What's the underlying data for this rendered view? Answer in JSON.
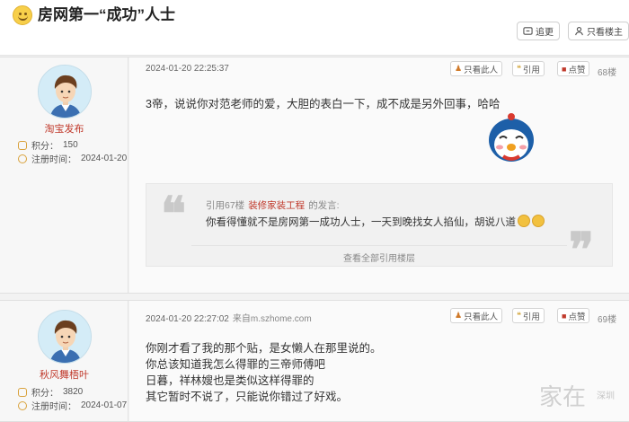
{
  "header": {
    "title": "房网第一“成功”人士",
    "btn_follow": "追更",
    "btn_only_op": "只看楼主"
  },
  "posts": [
    {
      "user": {
        "name": "淘宝发布",
        "score_label": "积分：",
        "score": "150",
        "reg_label": "注册时间：",
        "reg": "2024-01-20"
      },
      "time": "2024-01-20 22:25:37",
      "source": "",
      "btn_only": "只看此人",
      "btn_quote": "引用",
      "btn_like": "点赞",
      "floor": "68楼",
      "content": [
        "3帝，说说你对范老师的爱，大胆的表白一下，成不成是另外回事，哈哈"
      ],
      "quote": {
        "prefix": "引用67楼",
        "name": "装修家装工程",
        "suffix": "的发言:",
        "text": "你看得懂就不是房网第一成功人士，一天到晚找女人掐仙，胡说八道",
        "all": "查看全部引用楼层"
      }
    },
    {
      "user": {
        "name": "秋风舞梧叶",
        "score_label": "积分：",
        "score": "3820",
        "reg_label": "注册时间：",
        "reg": "2024-01-07"
      },
      "time": "2024-01-20 22:27:02",
      "source": "来自m.szhome.com",
      "btn_only": "只看此人",
      "btn_quote": "引用",
      "btn_like": "点赞",
      "floor": "69楼",
      "content": [
        "你刚才看了我的那个贴，是女懒人在那里说的。",
        "你总该知道我怎么得罪的三帝师傅吧",
        "日暮，祥林嫂也是类似这样得罪的",
        "其它暂时不说了，只能说你错过了好戏。"
      ]
    }
  ],
  "watermark": {
    "main": "家在",
    "sub": "深圳"
  },
  "colors": {
    "username": "#c0392b",
    "like_icon": "#c0392b"
  }
}
